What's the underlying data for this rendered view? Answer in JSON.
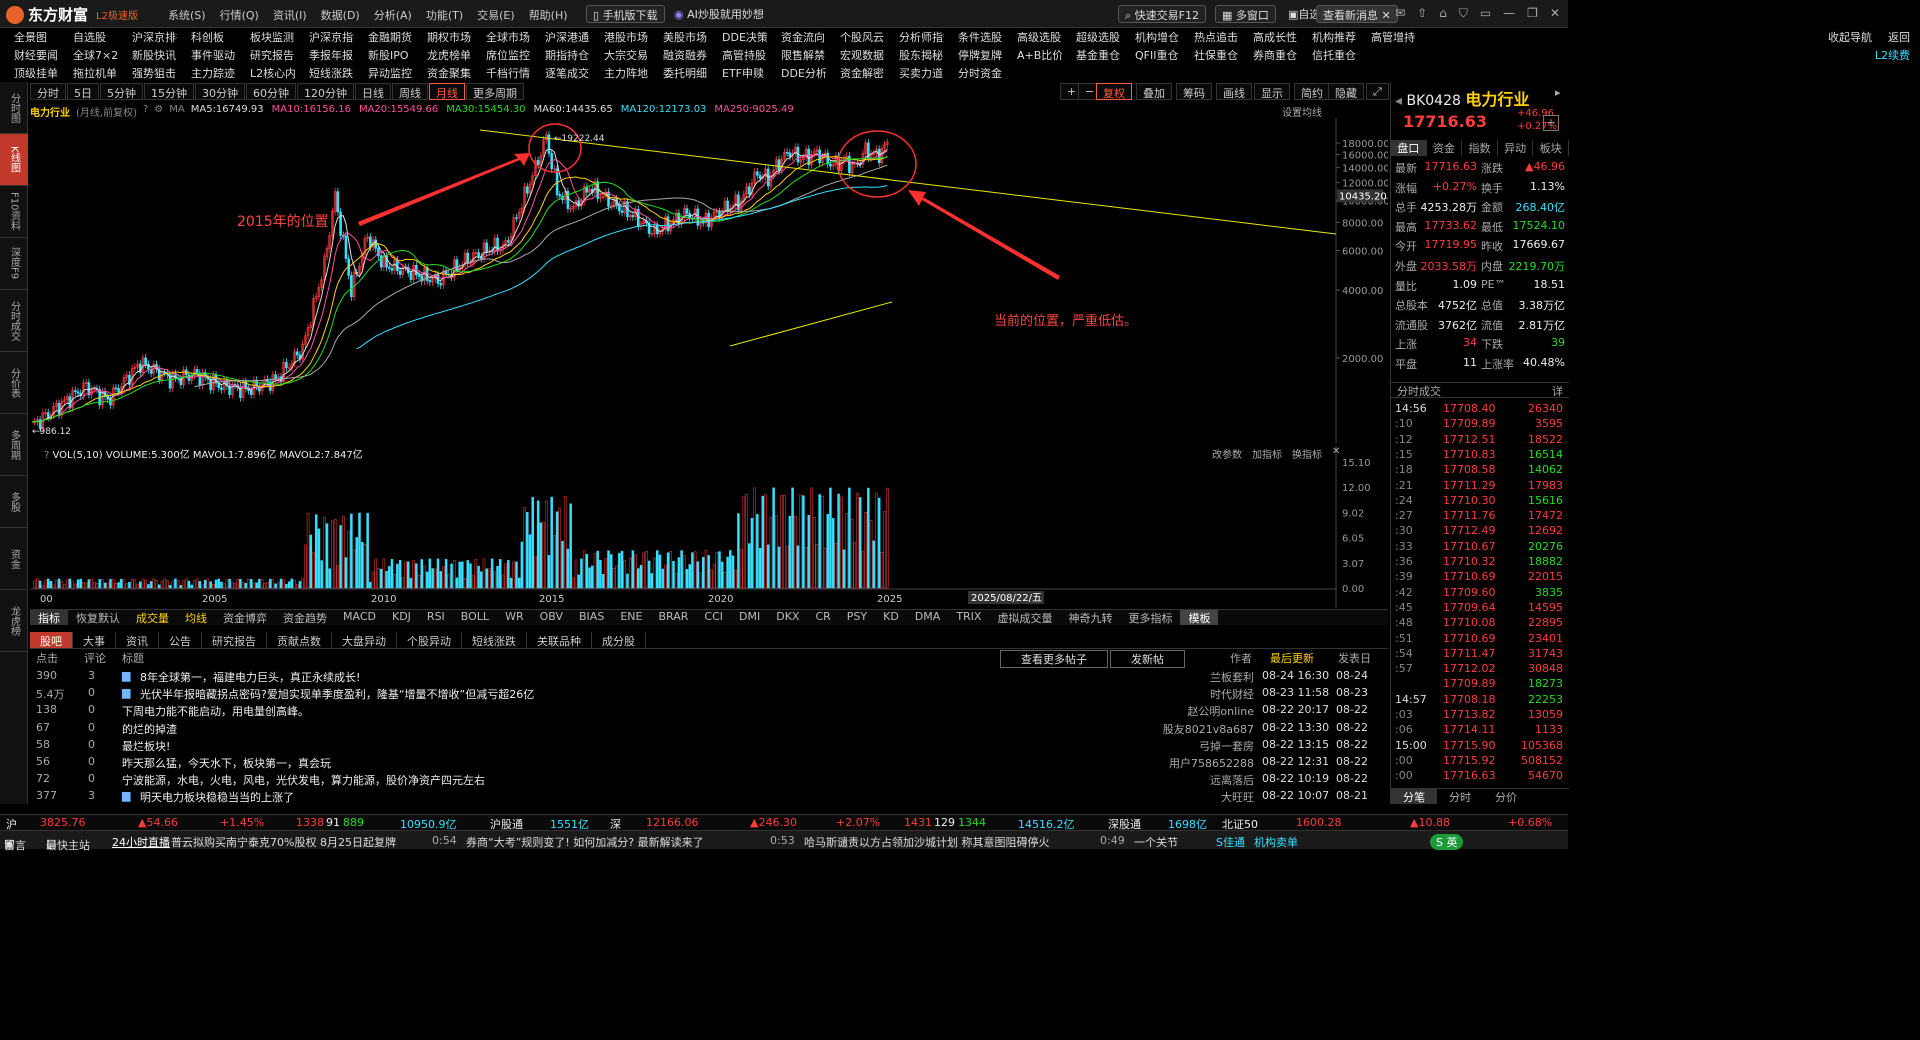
{
  "app": {
    "name": "东方财富",
    "edition": "L2极速版"
  },
  "top_menu": [
    "系统(S)",
    "行情(Q)",
    "资讯(I)",
    "数据(D)",
    "分析(A)",
    "功能(T)",
    "交易(E)",
    "帮助(H)"
  ],
  "top_pills": {
    "mobile": "手机版下载",
    "ai": "AI炒股就用妙想",
    "fast_trade": "快速交易F12",
    "multi_window": "多窗口",
    "self": "自选",
    "messages": "查看新消息"
  },
  "nav_rows": [
    [
      "全景图",
      "自选股",
      "沪深京排行",
      "科创板",
      "板块监测",
      "沪深京指数",
      "金融期货",
      "期权市场",
      "全球市场",
      "沪深港通",
      "港股市场",
      "美股市场",
      "DDE决策",
      "资金流向",
      "个股风云",
      "分析师指数",
      "条件选股",
      "高级选股",
      "超级选股",
      "机构增仓",
      "热点追击",
      "高成长性",
      "机构推荐",
      "高管增持"
    ],
    [
      "财经要闻",
      "全球7×24",
      "新股快讯",
      "事件驱动",
      "研究报告",
      "季报年报",
      "新股IPO",
      "龙虎榜单",
      "席位监控",
      "期指持仓",
      "大宗交易",
      "融资融券",
      "高管持股",
      "限售解禁",
      "宏观数据",
      "股东揭秘",
      "停牌复牌",
      "A+B比价",
      "基金重仓",
      "QFII重仓",
      "社保重仓",
      "券商重仓",
      "信托重仓"
    ],
    [
      "顶级挂单",
      "拖拉机单",
      "强势狙击",
      "主力踪迹",
      "L2核心内参",
      "短线涨跌",
      "异动监控",
      "资金聚集",
      "千档行情",
      "逐笔成交",
      "主力阵地",
      "委托明细",
      "ETF申赎",
      "DDE分析",
      "资金解密",
      "买卖力道",
      "分时资金"
    ]
  ],
  "nav_right": [
    "收起导航",
    "返回",
    "L2续费"
  ],
  "side_tabs": [
    "分时图",
    "K线图",
    "F10资料",
    "深度F9",
    "分时成交",
    "分价表",
    "多周期",
    "多股",
    "资金",
    "龙虎榜"
  ],
  "periods": [
    "分时",
    "5日",
    "5分钟",
    "15分钟",
    "30分钟",
    "60分钟",
    "120分钟",
    "日线",
    "周线",
    "月线",
    "更多周期"
  ],
  "active_period": "月线",
  "toolbar_right": [
    "复权",
    "叠加",
    "筹码",
    "画线",
    "显示",
    "简约",
    "隐藏"
  ],
  "ma_legend": {
    "title": "电力行业",
    "subtitle": "(月线,前复权)",
    "items": [
      {
        "text": "MA5:16749.93",
        "color": "#dddddd"
      },
      {
        "text": "MA10:16156.16",
        "color": "#ff4fa0"
      },
      {
        "text": "MA20:15549.66",
        "color": "#ff4fa0"
      },
      {
        "text": "MA30:15454.30",
        "color": "#22dd22"
      },
      {
        "text": "MA60:14435.65",
        "color": "#dddddd"
      },
      {
        "text": "MA120:12173.03",
        "color": "#36e0ff"
      },
      {
        "text": "MA250:9025.49",
        "color": "#ff4fa0"
      }
    ],
    "settings": "设置均线"
  },
  "chart_data": {
    "type": "candlestick",
    "x_ticks": [
      "2005",
      "2010",
      "2015",
      "2020",
      "2025"
    ],
    "y_ticks": [
      2000,
      4000,
      6000,
      8000,
      10000,
      12000,
      14000,
      16000,
      18000
    ],
    "y_scale": "log",
    "annotations": {
      "max": "19222.44",
      "min": "986.12",
      "cursor_price": "10435.20",
      "left_text": "2015年的位置",
      "right_text": "当前的位置，严重低估。"
    },
    "volume_legend": "VOL(5,10) VOLUME:5.300亿 MAVOL1:7.896亿 MAVOL2:7.847亿",
    "volume_ticks": [
      "15.10",
      "12.00",
      "9.02",
      "6.05",
      "3.07",
      "0.00"
    ],
    "volume_right": [
      "改参数",
      "加指标",
      "换指标"
    ],
    "date_cursor": "2025/08/22/五"
  },
  "indicator_tabs": [
    "指标",
    "恢复默认",
    "成交量",
    "均线",
    "资金博弈",
    "资金趋势",
    "MACD",
    "KDJ",
    "RSI",
    "BOLL",
    "WR",
    "OBV",
    "BIAS",
    "ENE",
    "BRAR",
    "CCI",
    "DMI",
    "DKX",
    "CR",
    "PSY",
    "KD",
    "DMA",
    "TRIX",
    "虚拟成交量",
    "神奇九转",
    "更多指标",
    "模板"
  ],
  "news_tabs": [
    "股吧",
    "大事",
    "资讯",
    "公告",
    "研究报告",
    "贡献点数",
    "大盘异动",
    "个股异动",
    "短线涨跌",
    "关联品种",
    "成分股"
  ],
  "news_header": {
    "clicks": "点击",
    "comments": "评论",
    "title": "标题",
    "more": "查看更多帖子",
    "post": "发新帖",
    "author": "作者",
    "last_update": "最后更新",
    "post_date": "发表日"
  },
  "news": [
    {
      "clicks": "390",
      "comments": "3",
      "title": "8年全球第一，福建电力巨头，真正永续成长!",
      "author": "兰板套利",
      "updated": "08-24 16:30",
      "date": "08-24",
      "img": true
    },
    {
      "clicks": "5.4万",
      "comments": "0",
      "title": "光伏半年报暗藏拐点密码?爱旭实现单季度盈利，隆基“增量不增收”但减亏超26亿",
      "author": "时代财经",
      "updated": "08-23 11:58",
      "date": "08-23",
      "img": true
    },
    {
      "clicks": "138",
      "comments": "0",
      "title": "下周电力能不能启动，用电量创高峰。",
      "author": "赵公明online",
      "updated": "08-22 20:17",
      "date": "08-22",
      "img": false
    },
    {
      "clicks": "67",
      "comments": "0",
      "title": "的烂的掉渣",
      "author": "股友8021v8a687",
      "updated": "08-22 13:30",
      "date": "08-22",
      "img": false
    },
    {
      "clicks": "58",
      "comments": "0",
      "title": "最烂板块!",
      "author": "弓掉一套房",
      "updated": "08-22 13:15",
      "date": "08-22",
      "img": false
    },
    {
      "clicks": "56",
      "comments": "0",
      "title": "昨天那么猛，今天水下，板块第一，真会玩",
      "author": "用户758652288",
      "updated": "08-22 12:31",
      "date": "08-22",
      "img": false
    },
    {
      "clicks": "72",
      "comments": "0",
      "title": "宁波能源，水电，火电，风电，光伏发电，算力能源，股价净资产四元左右",
      "author": "远离落后",
      "updated": "08-22 10:19",
      "date": "08-22",
      "img": false
    },
    {
      "clicks": "377",
      "comments": "3",
      "title": "明天电力板块稳稳当当的上涨了",
      "author": "大旺旺",
      "updated": "08-22 10:07",
      "date": "08-21",
      "img": true
    }
  ],
  "quote": {
    "code": "BK0428",
    "name": "电力行业",
    "price": "17716.63",
    "change": "+46.96",
    "pct": "+0.27%"
  },
  "quote_tabs": [
    "盘口",
    "资金",
    "指数",
    "异动",
    "板块"
  ],
  "quote_rows": [
    {
      "l1": "最新",
      "v1": "17716.63",
      "c1": "red",
      "l2": "涨跌",
      "v2": "▲46.96",
      "c2": "red"
    },
    {
      "l1": "涨幅",
      "v1": "+0.27%",
      "c1": "red",
      "l2": "换手",
      "v2": "1.13%",
      "c2": "white"
    },
    {
      "l1": "总手",
      "v1": "4253.28万",
      "c1": "white",
      "l2": "金额",
      "v2": "268.40亿",
      "c2": "cyan"
    },
    {
      "l1": "最高",
      "v1": "17733.62",
      "c1": "red",
      "l2": "最低",
      "v2": "17524.10",
      "c2": "green"
    },
    {
      "l1": "今开",
      "v1": "17719.95",
      "c1": "red",
      "l2": "昨收",
      "v2": "17669.67",
      "c2": "white"
    },
    {
      "l1": "外盘",
      "v1": "2033.58万",
      "c1": "red",
      "l2": "内盘",
      "v2": "2219.70万",
      "c2": "green"
    },
    {
      "l1": "量比",
      "v1": "1.09",
      "c1": "white",
      "l2": "PE™",
      "v2": "18.51",
      "c2": "white"
    },
    {
      "l1": "总股本",
      "v1": "4752亿",
      "c1": "white",
      "l2": "总值",
      "v2": "3.38万亿",
      "c2": "white"
    },
    {
      "l1": "流通股",
      "v1": "3762亿",
      "c1": "white",
      "l2": "流值",
      "v2": "2.81万亿",
      "c2": "white"
    },
    {
      "l1": "上涨",
      "v1": "34",
      "c1": "red",
      "l2": "下跌",
      "v2": "39",
      "c2": "green"
    },
    {
      "l1": "平盘",
      "v1": "11",
      "c1": "white",
      "l2": "上涨率",
      "v2": "40.48%",
      "c2": "white"
    }
  ],
  "ticks_title": "分时成交",
  "ticks": [
    {
      "t": "14:56",
      "p": "17708.40",
      "v": "26340",
      "vc": "red"
    },
    {
      "t": ":10",
      "p": "17709.89",
      "v": "3595",
      "vc": "red"
    },
    {
      "t": ":12",
      "p": "17712.51",
      "v": "18522",
      "vc": "red"
    },
    {
      "t": ":15",
      "p": "17710.83",
      "v": "16514",
      "vc": "green"
    },
    {
      "t": ":18",
      "p": "17708.58",
      "v": "14062",
      "vc": "green"
    },
    {
      "t": ":21",
      "p": "17711.29",
      "v": "17983",
      "vc": "red"
    },
    {
      "t": ":24",
      "p": "17710.30",
      "v": "15616",
      "vc": "green"
    },
    {
      "t": ":27",
      "p": "17711.76",
      "v": "17472",
      "vc": "red"
    },
    {
      "t": ":30",
      "p": "17712.49",
      "v": "12692",
      "vc": "red"
    },
    {
      "t": ":33",
      "p": "17710.67",
      "v": "20276",
      "vc": "green"
    },
    {
      "t": ":36",
      "p": "17710.32",
      "v": "18882",
      "vc": "green"
    },
    {
      "t": ":39",
      "p": "17710.69",
      "v": "22015",
      "vc": "red"
    },
    {
      "t": ":42",
      "p": "17709.60",
      "v": "3835",
      "vc": "green"
    },
    {
      "t": ":45",
      "p": "17709.64",
      "v": "14595",
      "vc": "red"
    },
    {
      "t": ":48",
      "p": "17710.08",
      "v": "22895",
      "vc": "red"
    },
    {
      "t": ":51",
      "p": "17710.69",
      "v": "23401",
      "vc": "red"
    },
    {
      "t": ":54",
      "p": "17711.47",
      "v": "31743",
      "vc": "red"
    },
    {
      "t": ":57",
      "p": "17712.02",
      "v": "30848",
      "vc": "red"
    },
    {
      "t": "",
      "p": "17709.89",
      "v": "18273",
      "vc": "green"
    },
    {
      "t": "14:57",
      "p": "17708.18",
      "v": "22253",
      "vc": "green"
    },
    {
      "t": ":03",
      "p": "17713.82",
      "v": "13059",
      "vc": "red"
    },
    {
      "t": ":06",
      "p": "17714.11",
      "v": "1133",
      "vc": "red"
    },
    {
      "t": "15:00",
      "p": "17715.90",
      "v": "105368",
      "vc": "red"
    },
    {
      "t": ":00",
      "p": "17715.92",
      "v": "508152",
      "vc": "red"
    },
    {
      "t": ":00",
      "p": "17716.63",
      "v": "54670",
      "vc": "red"
    }
  ],
  "rp_bottom": [
    "分笔",
    "分时",
    "分价"
  ],
  "status": {
    "sh": "沪",
    "sh_idx": "3825.76",
    "sh_chg": "▲54.66",
    "sh_pct": "+1.45%",
    "sh_up": "1338",
    "sh_flat": "91",
    "sh_down": "889",
    "sh_amt": "10950.9亿",
    "hgt": "沪股通",
    "hgt_amt": "1551亿",
    "sz": "深",
    "sz_idx": "12166.06",
    "sz_chg": "▲246.30",
    "sz_pct": "+2.07%",
    "sz_up": "1431",
    "sz_flat": "129",
    "sz_down": "1344",
    "sz_amt": "14516.2亿",
    "sgt": "深股通",
    "sgt_amt": "1698亿",
    "bz": "北证50",
    "bz_idx": "1600.28",
    "bz_chg": "▲10.88",
    "bz_pct": "+0.68%"
  },
  "newsbar": {
    "left": "留言",
    "lh": "最快主站",
    "live": "24小时直播",
    "n1": "普云拟购买南宁泰克70%股权 8月25日起复牌",
    "t1": "0:54",
    "n2": "券商“大考”规则变了! 如何加减分? 最新解读来了",
    "t2": "0:53",
    "n3": "哈马斯谴责以方占领加沙城计划 称其意图阻碍停火",
    "t3": "0:49",
    "n4": "一个关节",
    "right1": "S佳通",
    "right2": "机构卖单"
  }
}
